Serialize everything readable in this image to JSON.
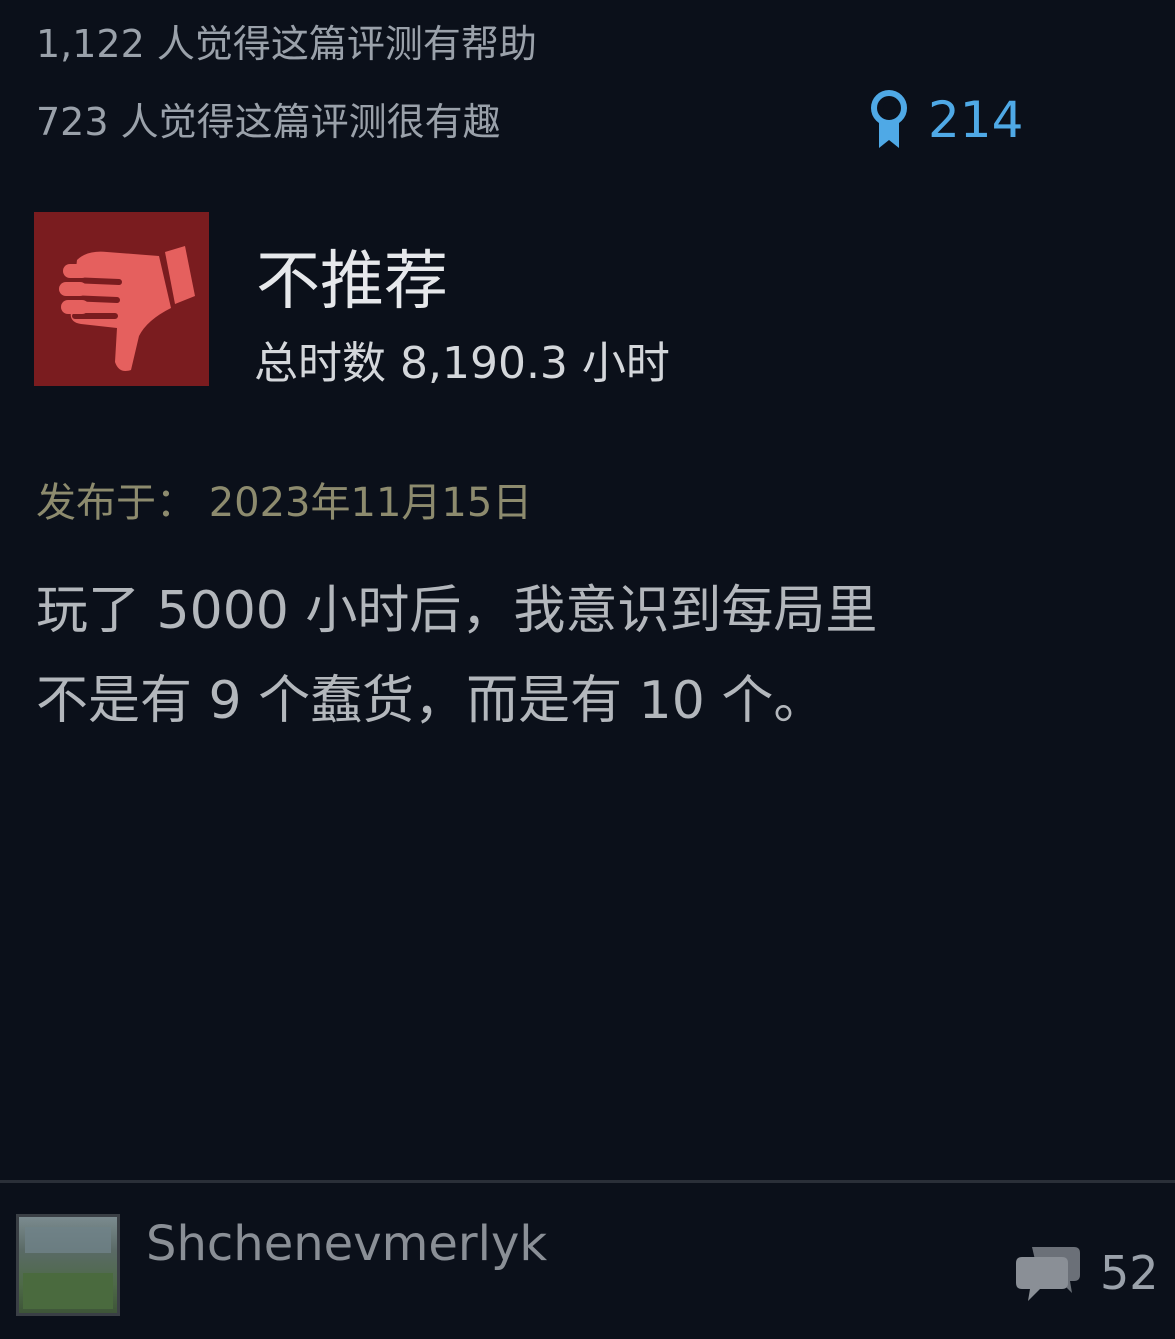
{
  "stats": {
    "helpful_text": "1,122 人觉得这篇评测有帮助",
    "funny_text": "723 人觉得这篇评测很有趣",
    "award_count": "214"
  },
  "review": {
    "verdict": "不推荐",
    "hours": "总时数 8,190.3 小时",
    "posted": "发布于： 2023年11月15日",
    "body_line_1": "玩了 5000 小时后，我意识到每局里",
    "body_line_2": "不是有 9 个蠢货，而是有 10 个。"
  },
  "author": {
    "username": "Shchenevmerlyk",
    "comment_count": "52"
  },
  "icons": {
    "award": "award-ribbon-icon",
    "verdict": "thumbs-down-icon",
    "comments": "speech-bubbles-icon"
  },
  "colors": {
    "background": "#0b101a",
    "award_blue": "#4fa9e6",
    "thumb_bg": "#7a1c1f",
    "thumb_fg": "#e5605e",
    "posted_olive": "#8d8b6e"
  }
}
